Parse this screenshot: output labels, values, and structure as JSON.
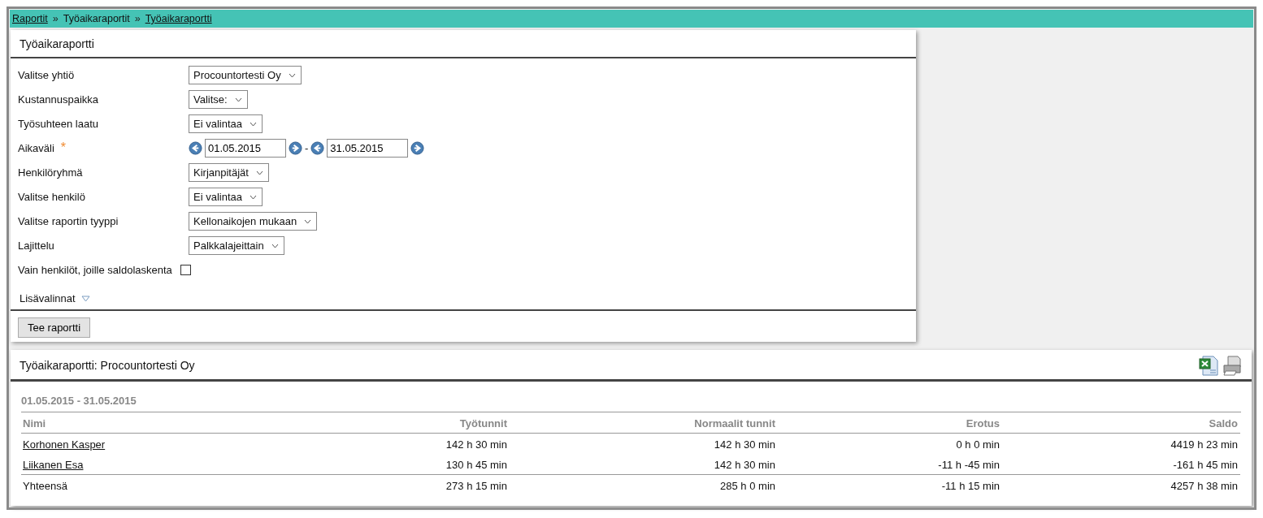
{
  "breadcrumb": [
    {
      "kind": "link",
      "label": "Raportit"
    },
    {
      "kind": "separator",
      "label": "»"
    },
    {
      "kind": "text",
      "label": "Työaikaraportit"
    },
    {
      "kind": "separator",
      "label": "»"
    },
    {
      "kind": "link",
      "label": "Työaikaraportti"
    }
  ],
  "form": {
    "title": "Työaikaraportti",
    "fields": [
      {
        "kind": "select",
        "label": "Valitse yhtiö",
        "value": "Procountortesti Oy"
      },
      {
        "kind": "select",
        "label": "Kustannuspaikka",
        "value": "Valitse:"
      },
      {
        "kind": "select",
        "label": "Työsuhteen laatu",
        "value": "Ei valintaa"
      },
      {
        "kind": "daterange",
        "label": "Aikaväli",
        "required_marker": "*",
        "from": "01.05.2015",
        "separator": "-",
        "to": "31.05.2015"
      },
      {
        "kind": "select",
        "label": "Henkilöryhmä",
        "value": "Kirjanpitäjät"
      },
      {
        "kind": "select",
        "label": "Valitse henkilö",
        "value": "Ei valintaa"
      },
      {
        "kind": "select",
        "label": "Valitse raportin tyyppi",
        "value": "Kellonaikojen mukaan"
      },
      {
        "kind": "select",
        "label": "Lajittelu",
        "value": "Palkkalajeittain"
      },
      {
        "kind": "checkbox",
        "label": "Vain henkilöt, joille saldolaskenta",
        "checked": false
      }
    ],
    "more_options": {
      "label": "Lisävalinnat",
      "expanded": false
    },
    "submit": "Tee raportti"
  },
  "report": {
    "title": "Työaikaraportti: Procountortesti Oy",
    "period": "01.05.2015 - 31.05.2015",
    "columns": [
      "Nimi",
      "Työtunnit",
      "Normaalit tunnit",
      "Erotus",
      "Saldo"
    ],
    "rows": [
      {
        "kind": "person",
        "cells": [
          "Korhonen Kasper",
          "142 h 30 min",
          "142 h 30 min",
          "0 h 0 min",
          "4419 h 23 min"
        ]
      },
      {
        "kind": "person",
        "cells": [
          "Liikanen Esa",
          "130 h 45 min",
          "142 h 30 min",
          "-11 h -45 min",
          "-161 h 45 min"
        ]
      },
      {
        "kind": "total",
        "cells": [
          "Yhteensä",
          "273 h 15 min",
          "285 h 0 min",
          "-11 h 15 min",
          "4257 h 38 min"
        ]
      }
    ]
  }
}
